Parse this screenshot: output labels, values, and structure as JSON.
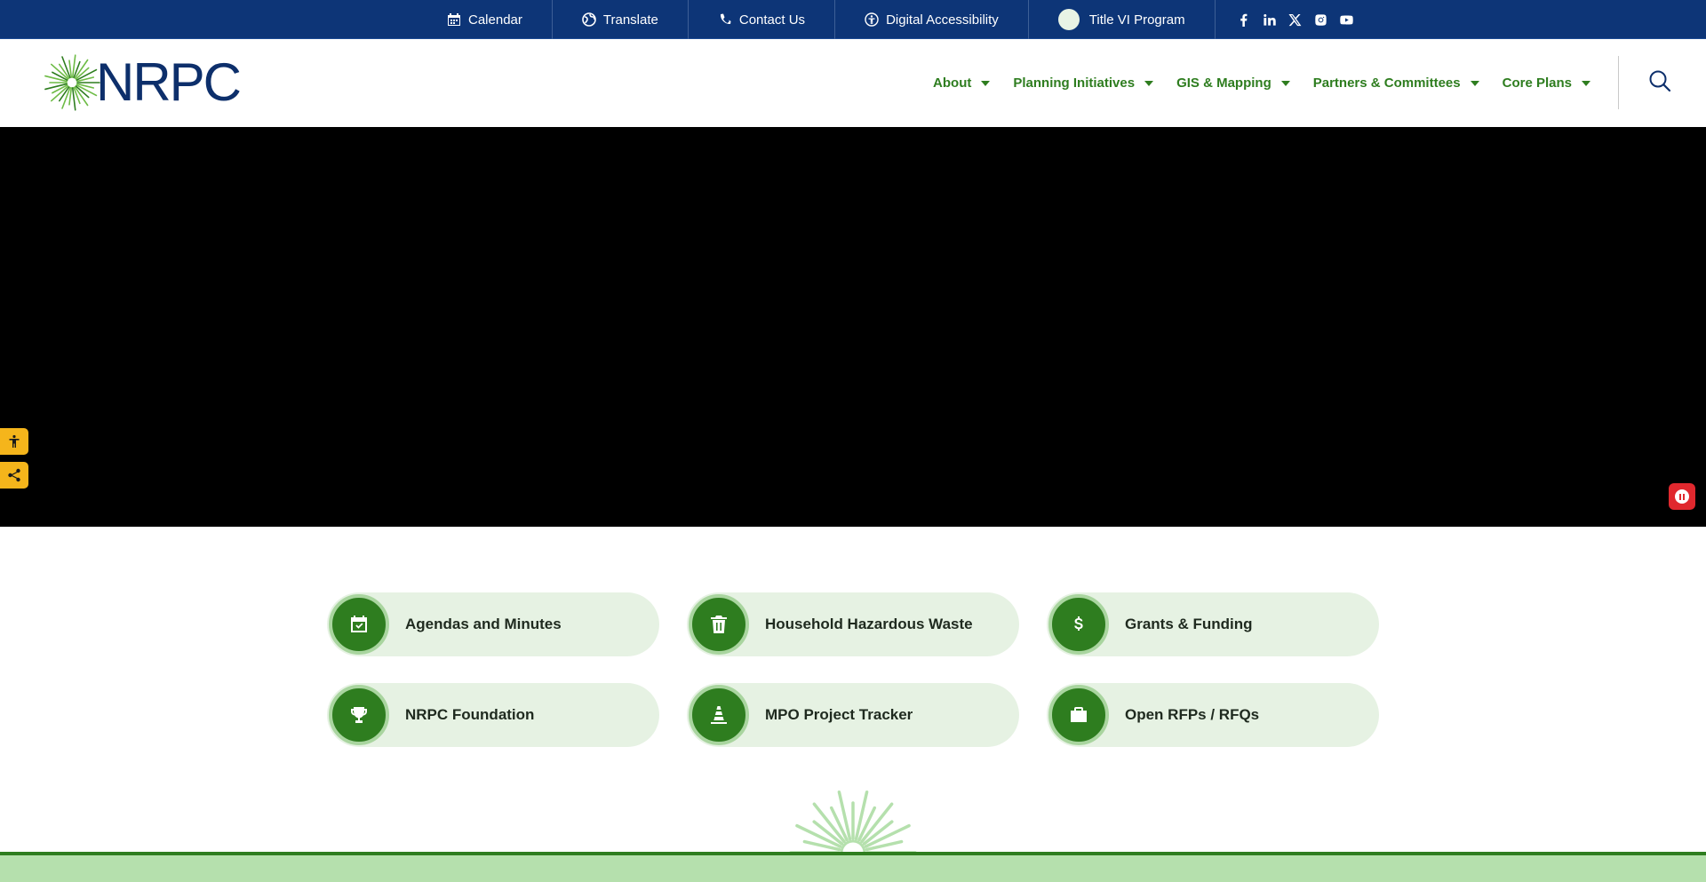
{
  "topbar": {
    "links": [
      {
        "label": "Calendar",
        "icon": "calendar-icon"
      },
      {
        "label": "Translate",
        "icon": "globe-icon"
      },
      {
        "label": "Contact Us",
        "icon": "phone-icon"
      },
      {
        "label": "Digital Accessibility",
        "icon": "accessibility-icon"
      },
      {
        "label": "Title VI Program",
        "icon": "title-vi-icon"
      }
    ],
    "social": [
      "facebook-icon",
      "linkedin-icon",
      "x-icon",
      "instagram-icon",
      "youtube-icon"
    ]
  },
  "header": {
    "logo_text": "NRPC",
    "nav": [
      {
        "label": "About"
      },
      {
        "label": "Planning Initiatives"
      },
      {
        "label": "GIS & Mapping"
      },
      {
        "label": "Partners & Committees"
      },
      {
        "label": "Core Plans"
      }
    ]
  },
  "quick_links": [
    {
      "label": "Agendas and Minutes",
      "icon": "calendar-check-icon"
    },
    {
      "label": "Household Hazardous Waste",
      "icon": "trash-icon"
    },
    {
      "label": "Grants & Funding",
      "icon": "dollar-icon"
    },
    {
      "label": "NRPC Foundation",
      "icon": "trophy-icon"
    },
    {
      "label": "MPO Project Tracker",
      "icon": "traffic-cone-icon"
    },
    {
      "label": "Open RFPs / RFQs",
      "icon": "briefcase-icon"
    }
  ],
  "colors": {
    "topbar": "#0d3577",
    "brand_green": "#2e7d1f",
    "card_bg": "#e6f2e3",
    "accent_yellow": "#f5b51b",
    "pause_red": "#e0282e"
  }
}
